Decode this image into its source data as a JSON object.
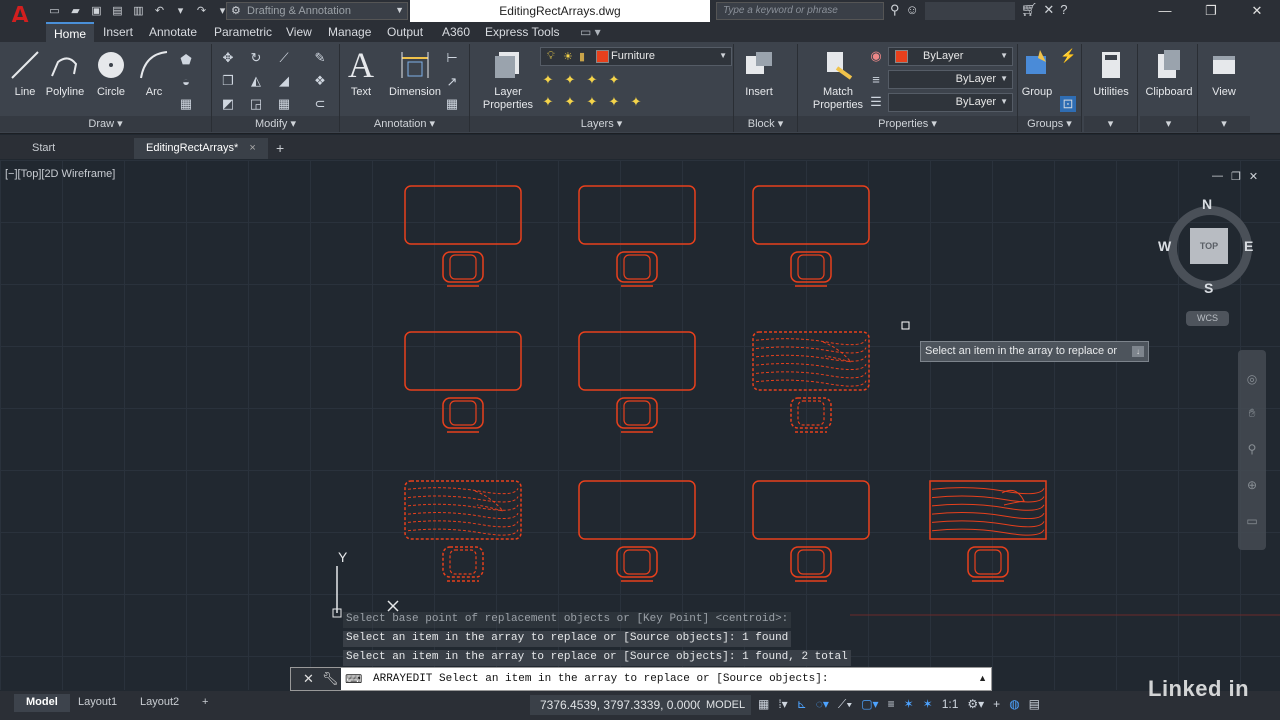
{
  "app": {
    "logo_letter": "A",
    "workspace": "Drafting & Annotation",
    "document_title": "EditingRectArrays.dwg",
    "search_placeholder": "Type a keyword or phrase"
  },
  "ribbon_tabs": [
    "Home",
    "Insert",
    "Annotate",
    "Parametric",
    "View",
    "Manage",
    "Output",
    "A360",
    "Express Tools"
  ],
  "ribbon": {
    "draw": {
      "buttons": [
        "Line",
        "Polyline",
        "Circle",
        "Arc"
      ],
      "footer": "Draw ▾"
    },
    "modify": {
      "footer": "Modify ▾"
    },
    "annotation": {
      "buttons": [
        "Text",
        "Dimension"
      ],
      "footer": "Annotation ▾"
    },
    "layers": {
      "button": "Layer Properties",
      "current_layer": "Furniture",
      "footer": "Layers ▾"
    },
    "block": {
      "button": "Insert",
      "footer": "Block ▾"
    },
    "properties": {
      "button": "Match Properties",
      "color": "ByLayer",
      "linetype": "ByLayer",
      "lineweight": "ByLayer",
      "footer": "Properties ▾"
    },
    "groups": {
      "button": "Group",
      "footer": "Groups ▾"
    },
    "utilities": {
      "button": "Utilities"
    },
    "clipboard": {
      "button": "Clipboard"
    },
    "view": {
      "button": "View"
    }
  },
  "file_tabs": [
    {
      "label": "Start"
    },
    {
      "label": "EditingRectArrays*"
    }
  ],
  "viewport": {
    "label": "[−][Top][2D Wireframe]",
    "viewcube": {
      "top": "TOP",
      "n": "N",
      "s": "S",
      "e": "E",
      "w": "W",
      "wcs": "WCS"
    }
  },
  "ucs": {
    "y_label": "Y"
  },
  "drawing": {
    "line_color": "#e8401c",
    "array": {
      "rows": 3,
      "columns": 3
    },
    "replaced_items": [
      {
        "row": 2,
        "column": 3,
        "desk": "wood",
        "chair": "dashed"
      },
      {
        "row": 3,
        "column": 1,
        "desk": "wood",
        "chair": "dashed"
      }
    ],
    "source_object": {
      "desk": "wood",
      "chair": "solid"
    }
  },
  "tooltip": "Select an item in the array to replace or",
  "command_history": [
    "Select base point of replacement objects or [Key Point] <centroid>:",
    "Select an item in the array to replace or [Source objects]: 1 found",
    "Select an item in the array to replace or [Source objects]: 1 found, 2 total"
  ],
  "command_line": "ARRAYEDIT Select an item in the array to replace or [Source objects]:",
  "layout_tabs": [
    "Model",
    "Layout1",
    "Layout2"
  ],
  "status": {
    "coordinates": "7376.4539, 3797.3339, 0.0000",
    "model": "MODEL",
    "scale": "1:1"
  },
  "watermark": "Linked in"
}
